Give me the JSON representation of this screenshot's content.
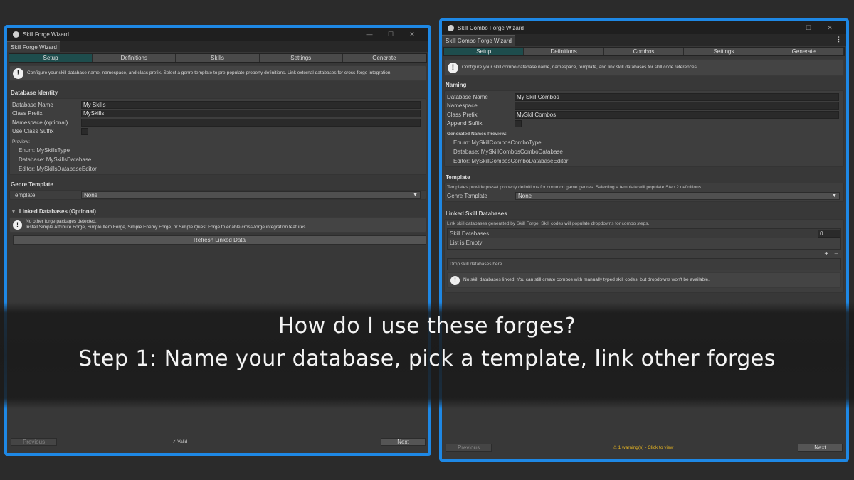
{
  "left": {
    "window_title": "Skill Forge Wizard",
    "tab_label": "Skill Forge Wizard",
    "steps": [
      "Setup",
      "Definitions",
      "Skills",
      "Settings",
      "Generate"
    ],
    "info_text": "Configure your skill database name, namespace, and class prefix. Select a genre template to pre-populate property definitions. Link external databases for cross-forge integration.",
    "identity_header": "Database Identity",
    "fields": [
      {
        "label": "Database Name",
        "value": "My Skills"
      },
      {
        "label": "Class Prefix",
        "value": "MySkills"
      },
      {
        "label": "Namespace (optional)",
        "value": ""
      }
    ],
    "suffix_label": "Use Class Suffix",
    "preview_label": "Preview:",
    "preview": [
      "Enum: MySkillsType",
      "Database: MySkillsDatabase",
      "Editor: MySkillsDatabaseEditor"
    ],
    "genre_header": "Genre Template",
    "template_label": "Template",
    "template_value": "None",
    "linked_header": "Linked Databases (Optional)",
    "linked_line1": "No other forge packages detected.",
    "linked_line2": "Install Simple Attribute Forge, Simple Item Forge, Simple Enemy Forge, or Simple Quest Forge to enable cross-forge integration features.",
    "refresh_label": "Refresh Linked Data",
    "prev_label": "Previous",
    "status": "✓ Valid",
    "next_label": "Next"
  },
  "right": {
    "window_title": "Skill Combo Forge Wizard",
    "tab_label": "Skill Combo Forge Wizard",
    "steps": [
      "Setup",
      "Definitions",
      "Combos",
      "Settings",
      "Generate"
    ],
    "info_text": "Configure your skill combo database name, namespace, template, and link skill databases for skill code references.",
    "naming_header": "Naming",
    "fields": [
      {
        "label": "Database Name",
        "value": "My Skill Combos"
      },
      {
        "label": "Namespace",
        "value": ""
      },
      {
        "label": "Class Prefix",
        "value": "MySkillCombos"
      }
    ],
    "append_label": "Append Suffix",
    "preview_label": "Generated Names Preview:",
    "preview": [
      "Enum: MySkillCombosComboType",
      "Database: MySkillCombosComboDatabase",
      "Editor: MySkillCombosComboDatabaseEditor"
    ],
    "template_header": "Template",
    "template_desc": "Templates provide preset property definitions for common game genres. Selecting a template will populate Step 2 definitions.",
    "genre_label": "Genre Template",
    "genre_value": "None",
    "linked_header": "Linked Skill Databases",
    "linked_desc": "Link skill databases generated by Skill Forge. Skill codes will populate dropdowns for combo steps.",
    "list_label": "Skill Databases",
    "list_count": "0",
    "list_empty": "List is Empty",
    "add_symbol": "+",
    "remove_symbol": "−",
    "drop_text": "Drop skill databases here",
    "warn_text": "No skill databases linked. You can still create combos with manually typed skill codes, but dropdowns won't be available.",
    "prev_label": "Previous",
    "status": "⚠ 1 warning(s) - Click to view",
    "next_label": "Next"
  },
  "overlay": {
    "line1": "How do I use these forges?",
    "line2": "Step 1: Name your database, pick a template, link other forges"
  },
  "colors": {
    "frame": "#1e88e5",
    "active_tab": "#1e4d4d",
    "warning": "#e6b422"
  }
}
